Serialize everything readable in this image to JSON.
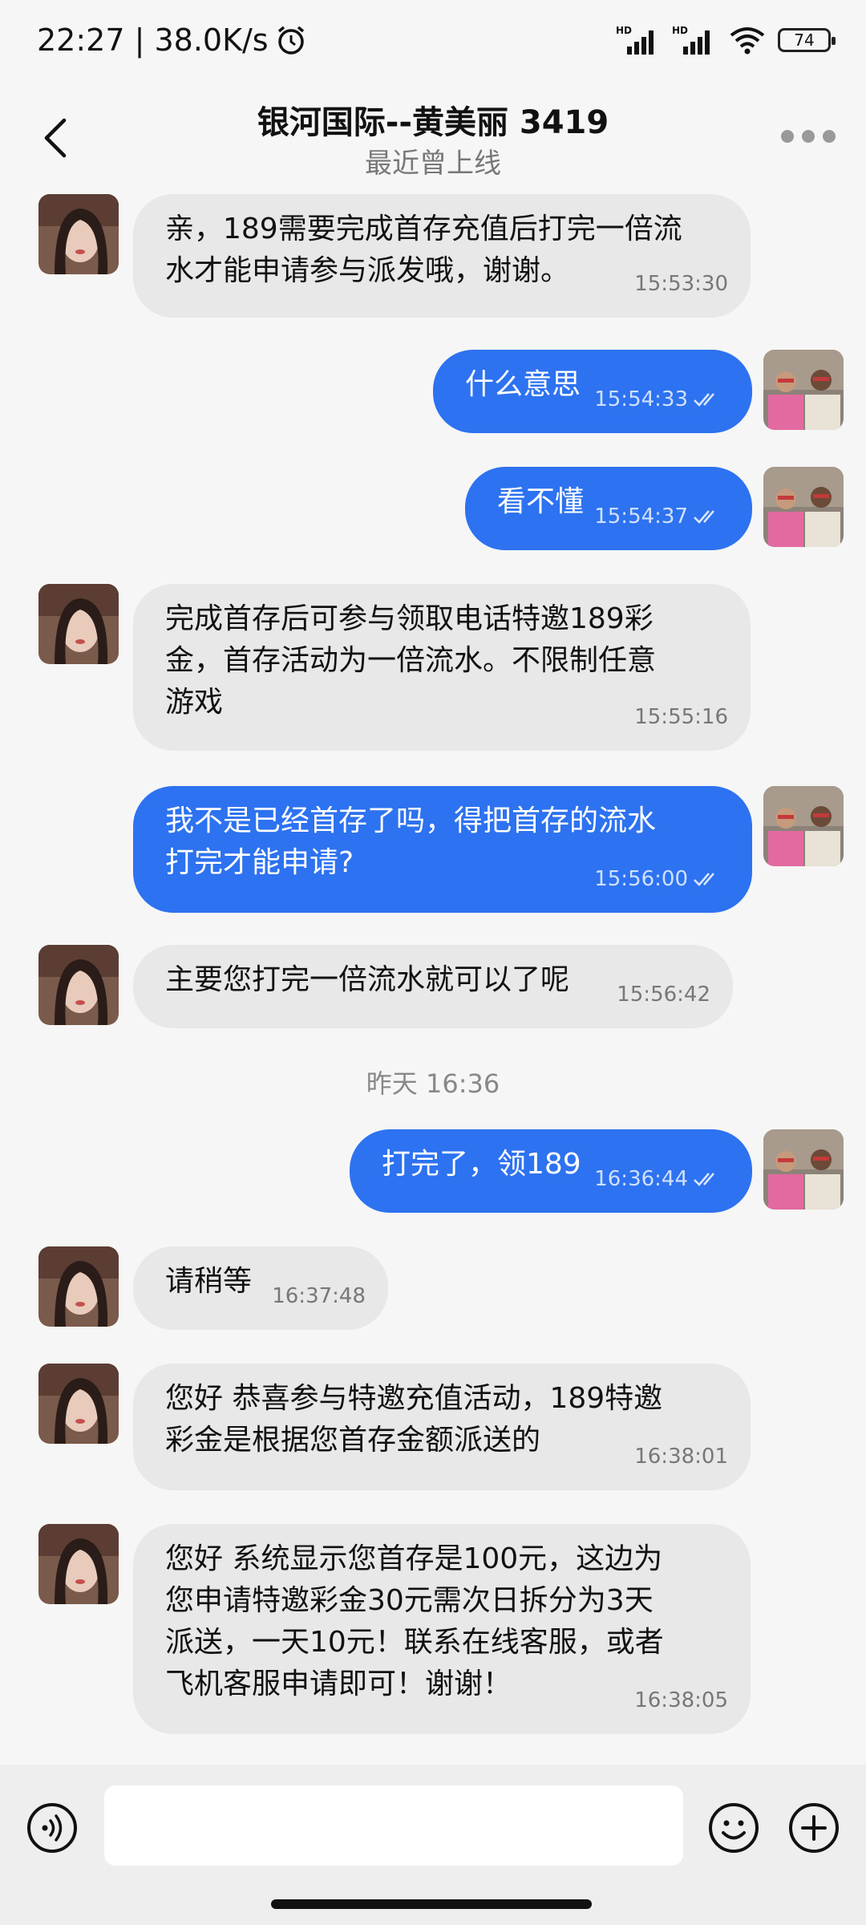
{
  "status": {
    "time_speed": "22:27 | 38.0K/s",
    "battery": "74",
    "signal1": "HD",
    "signal2": "HD"
  },
  "header": {
    "title": "银河国际--黄美丽 3419",
    "subtitle": "最近曾上线"
  },
  "messages": [
    {
      "side": "in",
      "text": "亲，189需要完成首存充值后打完一倍流\n水才能申请参与派发哦，谢谢。",
      "time": "15:53:30"
    },
    {
      "side": "out",
      "text": "什么意思",
      "time": "15:54:33"
    },
    {
      "side": "out",
      "text": "看不懂",
      "time": "15:54:37"
    },
    {
      "side": "in",
      "text": "完成首存后可参与领取电话特邀189彩\n金，首存活动为一倍流水。不限制任意\n游戏",
      "time": "15:55:16"
    },
    {
      "side": "out",
      "text": "我不是已经首存了吗，得把首存的流水\n打完才能申请?",
      "time": "15:56:00"
    },
    {
      "side": "in",
      "text": "主要您打完一倍流水就可以了呢",
      "time": "15:56:42"
    },
    {
      "side": "out",
      "text": "打完了，领189",
      "time": "16:36:44"
    },
    {
      "side": "in",
      "text": "请稍等",
      "time": "16:37:48"
    },
    {
      "side": "in",
      "text": "您好 恭喜参与特邀充值活动，189特邀\n彩金是根据您首存金额派送的",
      "time": "16:38:01"
    },
    {
      "side": "in",
      "text": "您好 系统显示您首存是100元，这边为\n您申请特邀彩金30元需次日拆分为3天\n派送，一天10元！联系在线客服，或者\n飞机客服申请即可！谢谢！",
      "time": "16:38:05"
    }
  ],
  "date_separator": "昨天 16:36",
  "input": {
    "placeholder": ""
  },
  "icons": {
    "back": "back-arrow-icon",
    "more": "more-dots-icon",
    "voice": "voice-icon",
    "emoji": "emoji-icon",
    "add": "plus-icon",
    "read": "double-check-icon"
  },
  "colors": {
    "outgoing_bubble": "#2d72f0",
    "incoming_bubble": "#e8e8e8",
    "background": "#f6f6f6"
  }
}
